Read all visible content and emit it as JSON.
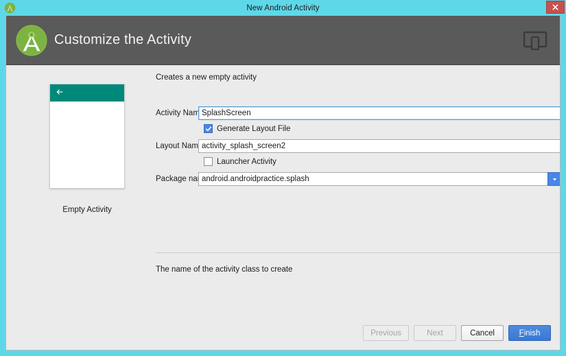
{
  "window": {
    "title": "New Android Activity",
    "icon": "android-studio-icon",
    "close_label": "x",
    "border_color": "#5ed8e8"
  },
  "header": {
    "title": "Customize the Activity",
    "logo_icon": "android-studio-logo",
    "device_icon": "devices-icon",
    "background_color": "#5a5a5a"
  },
  "preview": {
    "label": "Empty Activity",
    "appbar_color": "#00897b",
    "back_icon": "back-arrow-icon"
  },
  "form": {
    "description": "Creates a new empty activity",
    "activity_name": {
      "label": "Activity Name:",
      "value": "SplashScreen",
      "focused": true
    },
    "generate_layout_file": {
      "label": "Generate Layout File",
      "checked": true
    },
    "layout_name": {
      "label": "Layout Name:",
      "value": "activity_splash_screen2",
      "focused": false
    },
    "launcher_activity": {
      "label": "Launcher Activity",
      "checked": false
    },
    "package_name": {
      "label": "Package name:",
      "value": "android.androidpractice.splash",
      "dropdown_icon": "chevron-down-icon",
      "dropdown_color": "#4a86e8"
    },
    "help_text": "The name of the activity class to create"
  },
  "footer": {
    "previous_label": "Previous",
    "next_label": "Next",
    "cancel_label": "Cancel",
    "finish_label": "Finish",
    "finish_mnemonic": "F",
    "finish_rest": "inish",
    "previous_enabled": false,
    "next_enabled": false
  }
}
